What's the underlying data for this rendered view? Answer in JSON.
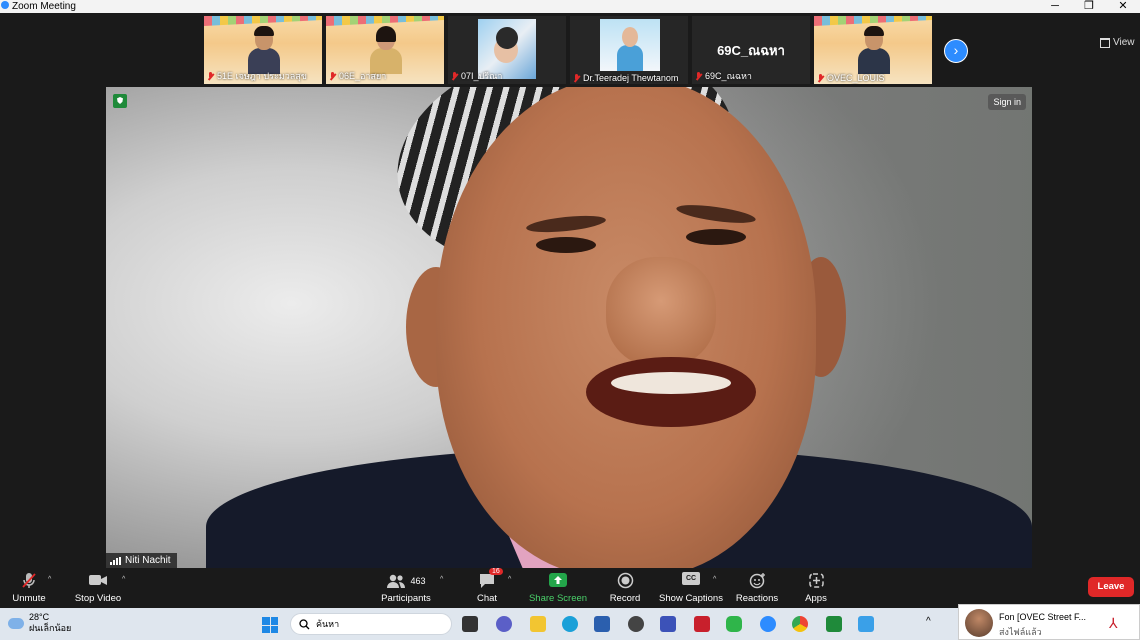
{
  "window": {
    "title": "Zoom Meeting",
    "min": "─",
    "max": "❐",
    "close": "✕"
  },
  "gallery": {
    "participants": [
      {
        "name": "51E เจษฎา ประมวลสุข",
        "kind": "banner"
      },
      {
        "name": "06E_อาสยา",
        "kind": "banner"
      },
      {
        "name": "07I_ปรีณา",
        "kind": "photo"
      },
      {
        "name": "Dr.Teeradej Thewtanom",
        "kind": "photo"
      },
      {
        "name": "69C_ณฉหา",
        "kind": "name-only",
        "display": "69C_ณฉหา"
      },
      {
        "name": "OVEC_LOUIS",
        "kind": "banner"
      }
    ],
    "next_icon": "chevron-right-icon",
    "view_label": "View"
  },
  "main_video": {
    "speaker_name": "Niti Nachit",
    "sign_in": "Sign in"
  },
  "toolbar": {
    "unmute": "Unmute",
    "stop_video": "Stop Video",
    "participants": "Participants",
    "participants_count": "463",
    "chat": "Chat",
    "chat_badge": "16",
    "share_screen": "Share Screen",
    "record": "Record",
    "show_captions": "Show Captions",
    "cc": "CC",
    "reactions": "Reactions",
    "apps": "Apps",
    "leave": "Leave"
  },
  "taskbar": {
    "temp": "28°C",
    "weather": "ฝนเล็กน้อย",
    "search_placeholder": "ค้นหา"
  },
  "notification": {
    "title": "Fon [OVEC Street F...",
    "subtitle": "ส่งไฟล์แล้ว"
  },
  "colors": {
    "accent": "#2d8cff",
    "leave": "#e02828",
    "share": "#23a54a"
  }
}
